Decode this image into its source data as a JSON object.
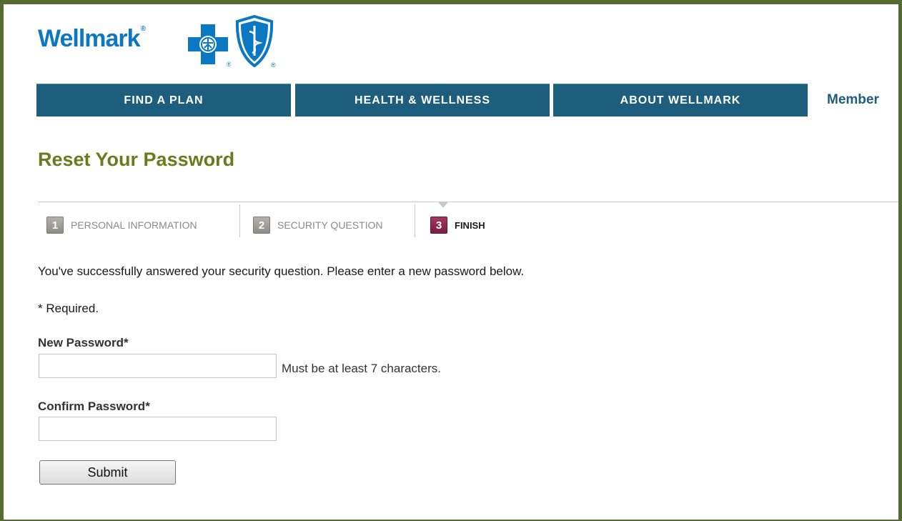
{
  "brand": {
    "logo_text": "Wellmark",
    "registered_mark": "®"
  },
  "nav": {
    "tabs": [
      {
        "label": "FIND A PLAN"
      },
      {
        "label": "HEALTH & WELLNESS"
      },
      {
        "label": "ABOUT WELLMARK"
      }
    ],
    "member_label": "Member"
  },
  "page": {
    "title": "Reset Your Password"
  },
  "steps": [
    {
      "number": "1",
      "label": "PERSONAL INFORMATION",
      "state": "inactive"
    },
    {
      "number": "2",
      "label": "SECURITY QUESTION",
      "state": "inactive"
    },
    {
      "number": "3",
      "label": "FINISH",
      "state": "active"
    }
  ],
  "form": {
    "intro": "You've successfully answered your security question. Please enter a new password below.",
    "required_note": "* Required.",
    "new_password": {
      "label": "New Password*",
      "value": "",
      "hint": "Must be at least 7 characters."
    },
    "confirm_password": {
      "label": "Confirm Password*",
      "value": ""
    },
    "submit_label": "Submit"
  },
  "colors": {
    "frame_border": "#556b2f",
    "nav_tab": "#1c5e7b",
    "title_olive": "#6b7a1e",
    "brand_blue": "#0a78c2",
    "active_step": "#7a1c42"
  }
}
